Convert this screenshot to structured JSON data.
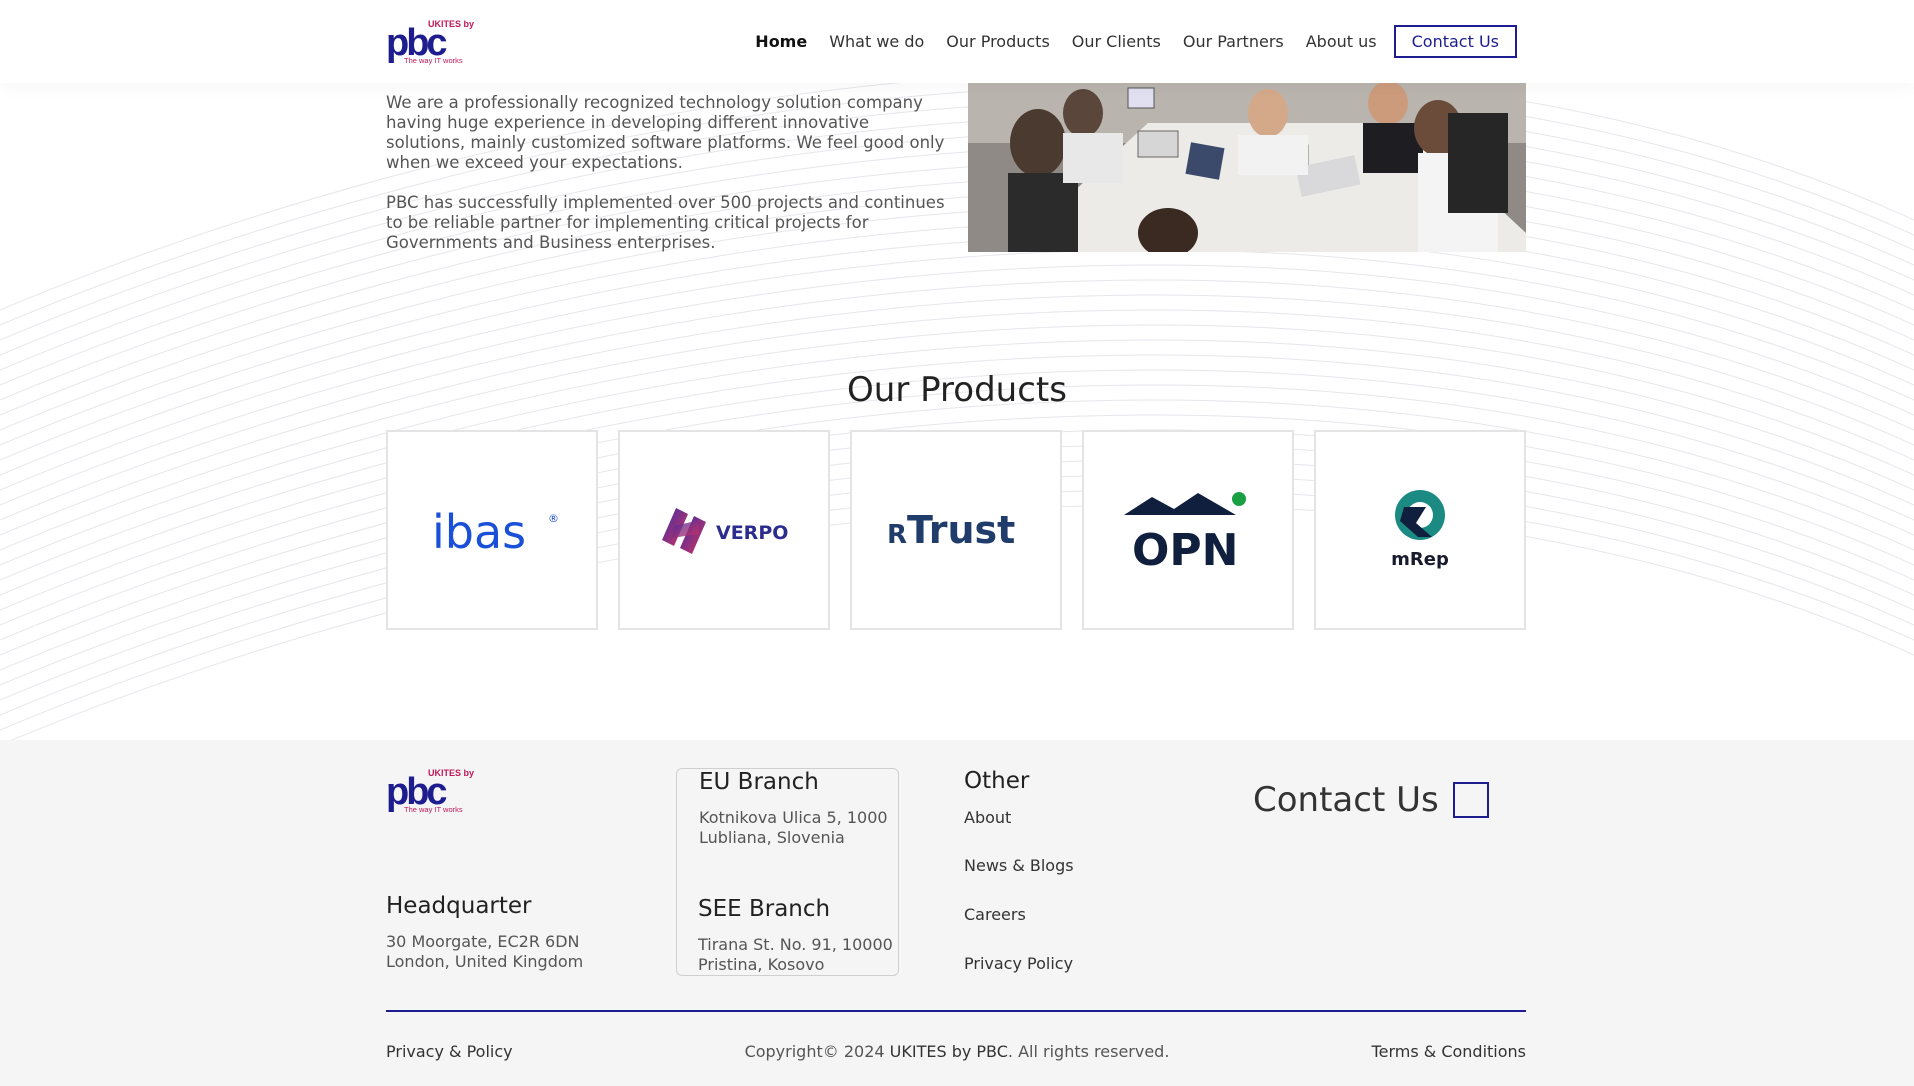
{
  "brand": {
    "logo_text": "pbc",
    "logo_superscript": "UKITES by",
    "tagline": "The way IT works",
    "primary_color": "#1d1d8f",
    "accent_color": "#c0185a"
  },
  "nav": {
    "items": [
      {
        "label": "Home",
        "active": true
      },
      {
        "label": "What we do"
      },
      {
        "label": "Our Products"
      },
      {
        "label": "Our Clients"
      },
      {
        "label": "Our Partners"
      },
      {
        "label": "About us"
      }
    ],
    "contact_label": "Contact Us"
  },
  "intro": {
    "paragraph1": "We are a professionally recognized technology solution company having huge experience in developing different innovative solutions, mainly customized software platforms. We feel good only when we exceed your expectations.",
    "paragraph2": "PBC has successfully implemented over 500 projects and continues to be reliable partner for implementing critical projects for Governments and Business enterprises."
  },
  "products": {
    "title": "Our Products",
    "items": [
      {
        "name": "ibas",
        "mark": "®",
        "color": "#1a4fd8"
      },
      {
        "name": "VERPO",
        "color": "#2c2c8f"
      },
      {
        "name": "Trust",
        "prefix": "R",
        "color": "#1f3c6b"
      },
      {
        "name": "OPN",
        "color": "#0f1f3d"
      },
      {
        "name": "mRep",
        "color": "#1a1a2e"
      }
    ]
  },
  "footer": {
    "headquarter": {
      "title": "Headquarter",
      "line1": "30 Moorgate, EC2R 6DN",
      "line2": "London, United Kingdom"
    },
    "eu_branch": {
      "title": "EU Branch",
      "line1": "Kotnikova Ulica 5, 1000",
      "line2": "Lubliana, Slovenia"
    },
    "see_branch": {
      "title": "SEE Branch",
      "line1": "Tirana St. No. 91, 10000",
      "line2": "Pristina, Kosovo"
    },
    "other": {
      "title": "Other",
      "links": [
        "About",
        "News & Blogs",
        "Careers",
        "Privacy Policy"
      ]
    },
    "contact_us": "Contact Us",
    "privacy": "Privacy & Policy",
    "copyright_prefix": "Copyright© 2024 ",
    "copyright_brand": "UKITES by PBC",
    "copyright_suffix": ". All rights reserved.",
    "terms": "Terms & Conditions"
  }
}
